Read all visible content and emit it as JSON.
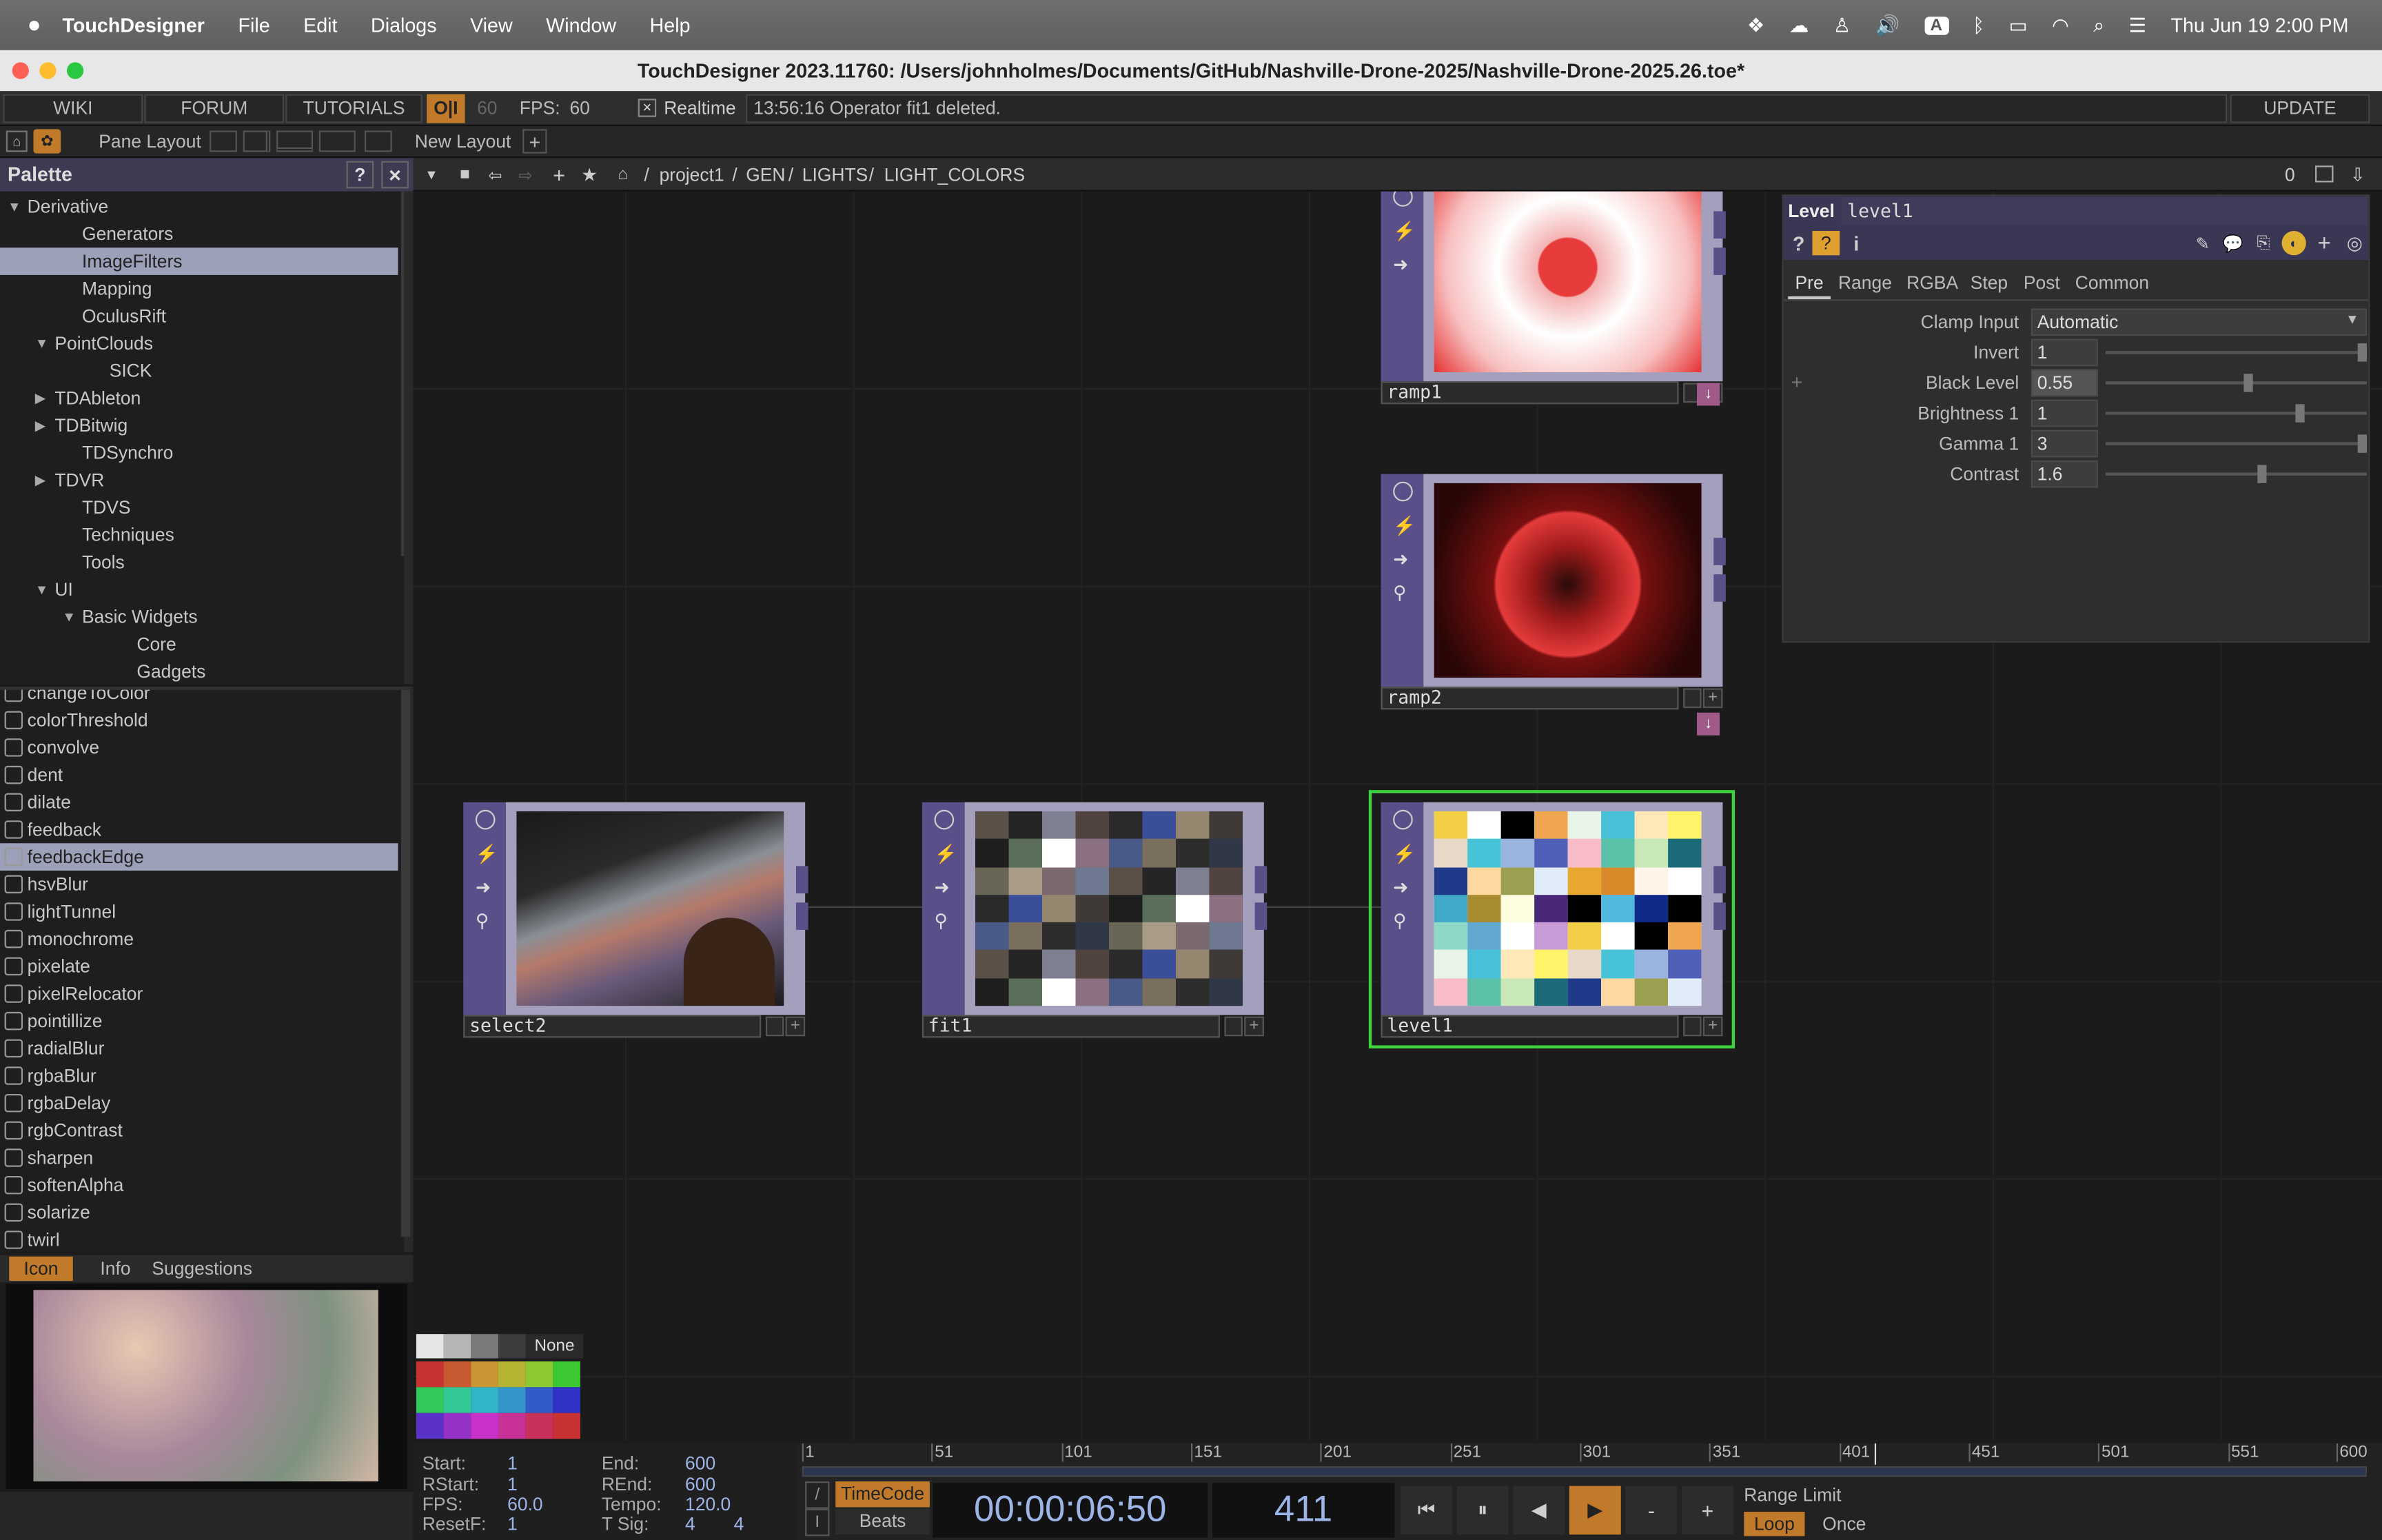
{
  "menubar": {
    "app": "TouchDesigner",
    "items": [
      "File",
      "Edit",
      "Dialogs",
      "View",
      "Window",
      "Help"
    ],
    "clock": "Thu Jun 19  2:00 PM",
    "input_source": "A"
  },
  "window": {
    "title": "TouchDesigner 2023.11760: /Users/johnholmes/Documents/GitHub/Nashville-Drone-2025/Nashville-Drone-2025.26.toe*"
  },
  "toolbar": {
    "wiki": "WIKI",
    "forum": "FORUM",
    "tutorials": "TUTORIALS",
    "oi": "O|I",
    "fps_cap": "60",
    "fps_label": "FPS:",
    "fps_value": "60",
    "realtime_label": "Realtime",
    "status": "13:56:16 Operator fit1 deleted.",
    "update": "UPDATE"
  },
  "panebar": {
    "pane_layout": "Pane Layout",
    "new_layout": "New Layout"
  },
  "palette": {
    "title": "Palette",
    "help": "?",
    "close": "×",
    "tree": [
      {
        "label": "Derivative",
        "indent": 0,
        "arrow": "down"
      },
      {
        "label": "Generators",
        "indent": 2,
        "arrow": ""
      },
      {
        "label": "ImageFilters",
        "indent": 2,
        "arrow": "",
        "selected": true
      },
      {
        "label": "Mapping",
        "indent": 2,
        "arrow": ""
      },
      {
        "label": "OculusRift",
        "indent": 2,
        "arrow": ""
      },
      {
        "label": "PointClouds",
        "indent": 1,
        "arrow": "down"
      },
      {
        "label": "SICK",
        "indent": 3,
        "arrow": ""
      },
      {
        "label": "TDAbleton",
        "indent": 1,
        "arrow": "right"
      },
      {
        "label": "TDBitwig",
        "indent": 1,
        "arrow": "right"
      },
      {
        "label": "TDSynchro",
        "indent": 2,
        "arrow": ""
      },
      {
        "label": "TDVR",
        "indent": 1,
        "arrow": "right"
      },
      {
        "label": "TDVS",
        "indent": 2,
        "arrow": ""
      },
      {
        "label": "Techniques",
        "indent": 2,
        "arrow": ""
      },
      {
        "label": "Tools",
        "indent": 2,
        "arrow": ""
      },
      {
        "label": "UI",
        "indent": 1,
        "arrow": "down"
      },
      {
        "label": "Basic Widgets",
        "indent": 2,
        "arrow": "down",
        "sub": true
      },
      {
        "label": "Core",
        "indent": 4,
        "arrow": ""
      },
      {
        "label": "Gadgets",
        "indent": 4,
        "arrow": ""
      }
    ],
    "list": [
      "changeToColor",
      "colorThreshold",
      "convolve",
      "dent",
      "dilate",
      "feedback",
      "feedbackEdge",
      "hsvBlur",
      "lightTunnel",
      "monochrome",
      "pixelate",
      "pixelRelocator",
      "pointillize",
      "radialBlur",
      "rgbaBlur",
      "rgbaDelay",
      "rgbContrast",
      "sharpen",
      "softenAlpha",
      "solarize",
      "twirl"
    ],
    "list_selected": "feedbackEdge",
    "tabs": [
      "Icon",
      "Info",
      "Suggestions"
    ]
  },
  "network": {
    "path": [
      "project1",
      "GEN",
      "LIGHTS",
      "LIGHT_COLORS"
    ],
    "count": "0",
    "nodes": {
      "ramp1": "ramp1",
      "ramp2": "ramp2",
      "select2": "select2",
      "fit1": "fit1",
      "level1": "level1"
    },
    "color_none": "None"
  },
  "params": {
    "type": "Level",
    "name": "level1",
    "tabs": [
      "Pre",
      "Range",
      "RGBA",
      "Step",
      "Post",
      "Common"
    ],
    "rows": [
      {
        "label": "Clamp Input",
        "value": "Automatic"
      },
      {
        "label": "Invert",
        "value": "1",
        "frac": 1.0
      },
      {
        "label": "Black Level",
        "value": "0.55",
        "frac": 0.55
      },
      {
        "label": "Brightness 1",
        "value": "1",
        "frac": 0.75
      },
      {
        "label": "Gamma 1",
        "value": "3",
        "frac": 1.0
      },
      {
        "label": "Contrast",
        "value": "1.6",
        "frac": 0.6
      }
    ]
  },
  "timeline": {
    "start_label": "Start:",
    "start": "1",
    "end_label": "End:",
    "end": "600",
    "rstart_label": "RStart:",
    "rstart": "1",
    "rend_label": "REnd:",
    "rend": "600",
    "fps_label": "FPS:",
    "fps": "60.0",
    "tempo_label": "Tempo:",
    "tempo": "120.0",
    "resetf_label": "ResetF:",
    "resetf": "1",
    "tsig_label": "T Sig:",
    "tsig_a": "4",
    "tsig_b": "4",
    "ticks": [
      "1",
      "51",
      "101",
      "151",
      "201",
      "251",
      "301",
      "351",
      "401",
      "451",
      "501",
      "551",
      "600"
    ],
    "timecode_btn": "TimeCode",
    "beats_btn": "Beats",
    "timecode": "00:00:06:50",
    "frame": "411",
    "minus": "-",
    "plus": "+",
    "range_limit": "Range Limit",
    "loop": "Loop",
    "once": "Once"
  }
}
